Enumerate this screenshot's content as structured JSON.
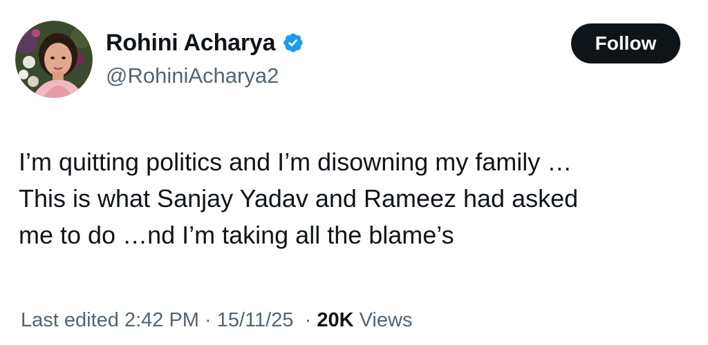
{
  "author": {
    "display_name": "Rohini Acharya",
    "handle": "@RohiniAcharya2",
    "verified": true,
    "verified_badge_color": "#1d9bf0",
    "avatar_icon": "profile-photo"
  },
  "follow_button": {
    "label": "Follow",
    "background": "#0f1419",
    "text_color": "#ffffff"
  },
  "tweet": {
    "lines": [
      "I’m quitting politics and I’m disowning my family …",
      "This is what Sanjay Yadav and Rameez had asked",
      "me to do …nd I’m taking all the blame’s"
    ]
  },
  "meta": {
    "edited_prefix": "Last edited",
    "time": "2:42 PM",
    "separator": "·",
    "date": "15/11/25",
    "views_count": "20K",
    "views_label": "Views"
  },
  "colors": {
    "text_primary": "#0f1419",
    "text_secondary": "#536471",
    "background": "#ffffff"
  }
}
